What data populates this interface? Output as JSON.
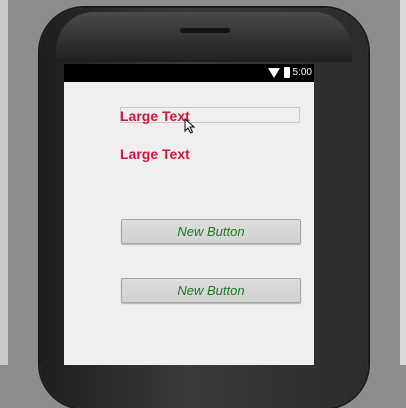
{
  "statusbar": {
    "time": "5:00",
    "wifi_icon": "wifi-icon",
    "battery_icon": "battery-icon"
  },
  "content": {
    "large_text_1": "Large Text",
    "large_text_2": "Large Text",
    "button_1": "New Button",
    "button_2": "New Button"
  },
  "colors": {
    "large_text": "#d2153c",
    "button_text": "#1a7a1a",
    "screen_bg": "#efefef"
  }
}
